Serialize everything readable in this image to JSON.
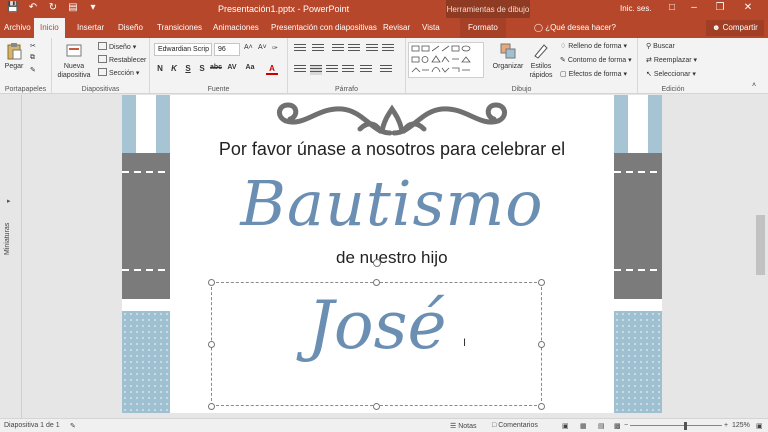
{
  "window": {
    "document_title": "Presentación1.pptx  -  PowerPoint",
    "tools_tab": "Herramientas de dibujo",
    "sign_in": "Inic. ses."
  },
  "tabs": [
    {
      "label": "Archivo"
    },
    {
      "label": "Inicio"
    },
    {
      "label": "Insertar"
    },
    {
      "label": "Diseño"
    },
    {
      "label": "Transiciones"
    },
    {
      "label": "Animaciones"
    },
    {
      "label": "Presentación con diapositivas"
    },
    {
      "label": "Revisar"
    },
    {
      "label": "Vista"
    },
    {
      "label": "Formato"
    }
  ],
  "tell_me": "¿Qué desea hacer?",
  "share": "Compartir",
  "ribbon": {
    "clipboard": {
      "paste": "Pegar",
      "label": "Portapapeles"
    },
    "slides": {
      "new_slide": "Nueva diapositiva",
      "layout": "Diseño",
      "reset": "Restablecer",
      "section": "Sección",
      "label": "Diapositivas"
    },
    "font": {
      "font_name": "Edwardian Scrip",
      "font_size": "96",
      "bold": "N",
      "italic": "K",
      "underline": "S",
      "shadow": "S",
      "strike": "abc",
      "spacing": "AV",
      "case": "Aa",
      "color": "A",
      "label": "Fuente"
    },
    "paragraph": {
      "label": "Párrafo"
    },
    "drawing": {
      "arrange": "Organizar",
      "quick_styles": "Estilos rápidos",
      "shape_fill": "Relleno de forma",
      "shape_outline": "Contorno de forma",
      "shape_effects": "Efectos de forma",
      "label": "Dibujo"
    },
    "editing": {
      "find": "Buscar",
      "replace": "Reemplazar",
      "select": "Seleccionar",
      "label": "Edición"
    }
  },
  "thumbnails_label": "Miniaturas",
  "slide": {
    "line1": "Por favor únase a nosotros para celebrar el",
    "line2": "Bautismo",
    "line3": "de nuestro hijo",
    "line4": "José",
    "accent_color": "#6b8fb3"
  },
  "status": {
    "slide_info": "Diapositiva 1 de 1",
    "notes": "Notas",
    "comments": "Comentarios",
    "zoom": "125%"
  },
  "colors": {
    "brand": "#b7472a",
    "tools_tab": "#8f3a22"
  }
}
